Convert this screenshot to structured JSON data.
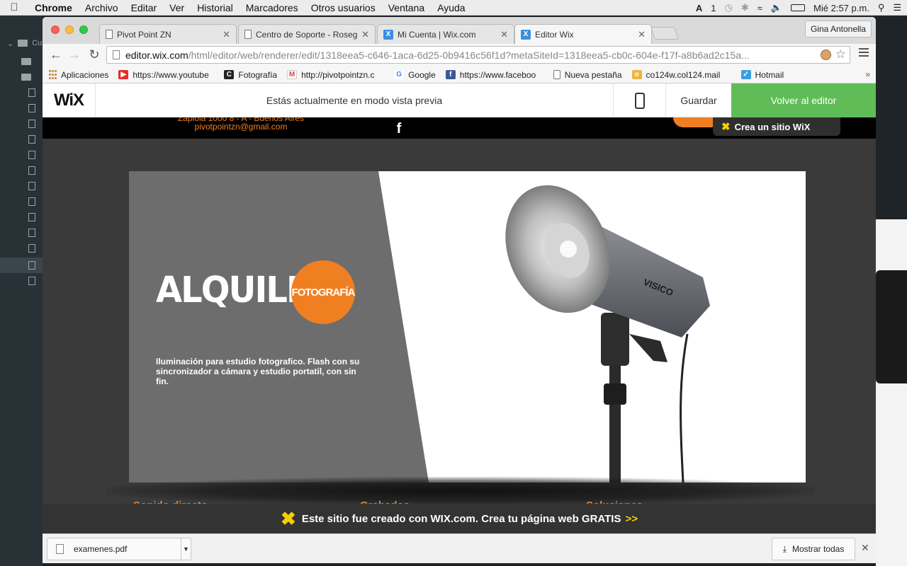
{
  "menubar": {
    "app_name": "Chrome",
    "items": [
      "Archivo",
      "Editar",
      "Ver",
      "Historial",
      "Marcadores",
      "Otros usuarios",
      "Ventana",
      "Ayuda"
    ],
    "battery_count": "1",
    "clock": "Mié 2:57 p.m."
  },
  "desktop": {
    "sidebar_label": "Cu"
  },
  "browser": {
    "profile_name": "Gina Antonella",
    "tabs": [
      {
        "label": "Pivot Point ZN",
        "icon": "page-icon",
        "active": false
      },
      {
        "label": "Centro de Soporte - Roseg",
        "icon": "page-icon",
        "active": false
      },
      {
        "label": "Mi Cuenta | Wix.com",
        "icon": "wix-icon",
        "active": false
      },
      {
        "label": "Editor Wix",
        "icon": "wix-icon",
        "active": true
      }
    ],
    "url_host": "editor.wix.com",
    "url_path": "/html/editor/web/renderer/edit/1318eea5-c646-1aca-6d25-0b9416c56f1d?metaSiteId=1318eea5-cb0c-604e-f17f-a8b6ad2c15a...",
    "bookmarks": [
      {
        "label": "Aplicaciones",
        "icon": "apps-grid-icon"
      },
      {
        "label": "https://www.youtube",
        "icon": "youtube-icon"
      },
      {
        "label": "Fotografía",
        "icon": "photo-icon"
      },
      {
        "label": "http://pivotpointzn.c",
        "icon": "gmail-icon"
      },
      {
        "label": "Google",
        "icon": "google-icon"
      },
      {
        "label": "https://www.faceboo",
        "icon": "facebook-icon"
      },
      {
        "label": "Nueva pestaña",
        "icon": "page-icon"
      },
      {
        "label": "co124w.col124.mail",
        "icon": "outlook-icon"
      },
      {
        "label": "Hotmail",
        "icon": "hotmail-icon"
      }
    ],
    "bookmarks_more": "»"
  },
  "wix_bar": {
    "logo": "WiX",
    "preview_text": "Estás actualmente en modo vista previa",
    "save_label": "Guardar",
    "back_label": "Volver al editor"
  },
  "site": {
    "address": "Zapiola 1000 8 - A - Buenos Aires",
    "email": "pivotpointzn@gmail.com",
    "facebook_glyph": "f",
    "crea_badge": "Crea un sitio WiX",
    "hero": {
      "title": "ALQUILER",
      "badge": "FOTOGRAFÍA",
      "description": "Iluminación para estudio fotografico. Flash con su sincronizador a cámara y estudio portatil, con sin fin.",
      "lamp_brand": "VISICO"
    },
    "peek_items": [
      "Sonido directo",
      "Grabados",
      "Soluciones"
    ],
    "banner": {
      "text": "Este sitio fue creado con WIX.com. Crea tu página web GRATIS",
      "arrows": ">>"
    }
  },
  "downloads": {
    "file_name": "examenes.pdf",
    "show_all": "Mostrar todas"
  },
  "colors": {
    "wix_green": "#60bc57",
    "site_orange": "#f07f22",
    "wix_yellow": "#f4d000"
  }
}
